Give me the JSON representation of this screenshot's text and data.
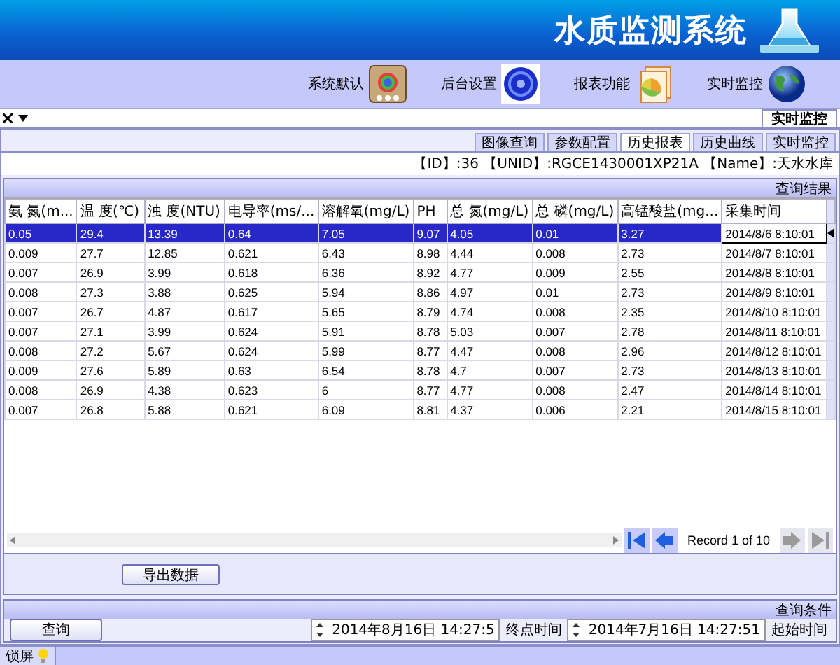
{
  "window": {
    "title": "水质监测系统"
  },
  "toolbar": [
    {
      "label": "系统默认",
      "kind": "palette"
    },
    {
      "label": "后台设置",
      "kind": "ring"
    },
    {
      "label": "报表功能",
      "kind": "report"
    },
    {
      "label": "实时监控",
      "kind": "globe"
    }
  ],
  "document_tabs": [
    {
      "label": "实时监控",
      "selected": true
    }
  ],
  "sub_tabs": [
    {
      "label": "图像查询",
      "selected": false
    },
    {
      "label": "参数配置",
      "selected": false
    },
    {
      "label": "历史报表",
      "selected": true
    },
    {
      "label": "历史曲线",
      "selected": false
    },
    {
      "label": "实时监控",
      "selected": false
    }
  ],
  "station_info": "【ID】:36 【UNID】:RGCE1430001XP21A 【Name】:天水水库",
  "results": {
    "title": "查询结果",
    "columns": [
      "氨 氮(m...",
      "温 度(℃)",
      "浊 度(NTU)",
      "电导率(ms/...",
      "溶解氧(mg/L)",
      "PH",
      "总 氮(mg/L)",
      "总 磷(mg/L)",
      "高锰酸盐(mg...",
      "采集时间"
    ],
    "rows": [
      {
        "selected": true,
        "cells": [
          "0.05",
          "29.4",
          "13.39",
          "0.64",
          "7.05",
          "9.07",
          "4.05",
          "0.01",
          "3.27",
          "2014/8/6 8:10:01"
        ]
      },
      {
        "selected": false,
        "cells": [
          "0.009",
          "27.7",
          "12.85",
          "0.621",
          "6.43",
          "8.98",
          "4.44",
          "0.008",
          "2.73",
          "2014/8/7 8:10:01"
        ]
      },
      {
        "selected": false,
        "cells": [
          "0.007",
          "26.9",
          "3.99",
          "0.618",
          "6.36",
          "8.92",
          "4.77",
          "0.009",
          "2.55",
          "2014/8/8 8:10:01"
        ]
      },
      {
        "selected": false,
        "cells": [
          "0.008",
          "27.3",
          "3.88",
          "0.625",
          "5.94",
          "8.86",
          "4.97",
          "0.01",
          "2.73",
          "2014/8/9 8:10:01"
        ]
      },
      {
        "selected": false,
        "cells": [
          "0.007",
          "26.7",
          "4.87",
          "0.617",
          "5.65",
          "8.79",
          "4.74",
          "0.008",
          "2.35",
          "2014/8/10 8:10:01"
        ]
      },
      {
        "selected": false,
        "cells": [
          "0.007",
          "27.1",
          "3.99",
          "0.624",
          "5.91",
          "8.78",
          "5.03",
          "0.007",
          "2.78",
          "2014/8/11 8:10:01"
        ]
      },
      {
        "selected": false,
        "cells": [
          "0.008",
          "27.2",
          "5.67",
          "0.624",
          "5.99",
          "8.77",
          "4.47",
          "0.008",
          "2.96",
          "2014/8/12 8:10:01"
        ]
      },
      {
        "selected": false,
        "cells": [
          "0.009",
          "27.6",
          "5.89",
          "0.63",
          "6.54",
          "8.78",
          "4.7",
          "0.007",
          "2.73",
          "2014/8/13 8:10:01"
        ]
      },
      {
        "selected": false,
        "cells": [
          "0.008",
          "26.9",
          "4.38",
          "0.623",
          "6",
          "8.77",
          "4.77",
          "0.008",
          "2.47",
          "2014/8/14 8:10:01"
        ]
      },
      {
        "selected": false,
        "cells": [
          "0.007",
          "26.8",
          "5.88",
          "0.621",
          "6.09",
          "8.81",
          "4.37",
          "0.006",
          "2.21",
          "2014/8/15 8:10:01"
        ]
      }
    ]
  },
  "pager": {
    "text": "Record 1 of 10",
    "buttons": [
      {
        "kind": "last",
        "disabled": false
      },
      {
        "kind": "next",
        "disabled": false
      },
      {
        "kind": "prev",
        "disabled": true
      },
      {
        "kind": "first",
        "disabled": true
      }
    ]
  },
  "export_button": "导出数据",
  "query": {
    "title": "查询条件",
    "start_label": "起始时间",
    "start_value": "2014年7月16日 14:27:51",
    "end_label": "终点时间",
    "end_value": "2014年8月16日 14:27:5",
    "button": "查询"
  },
  "status_bar": {
    "text": "锁屏"
  }
}
